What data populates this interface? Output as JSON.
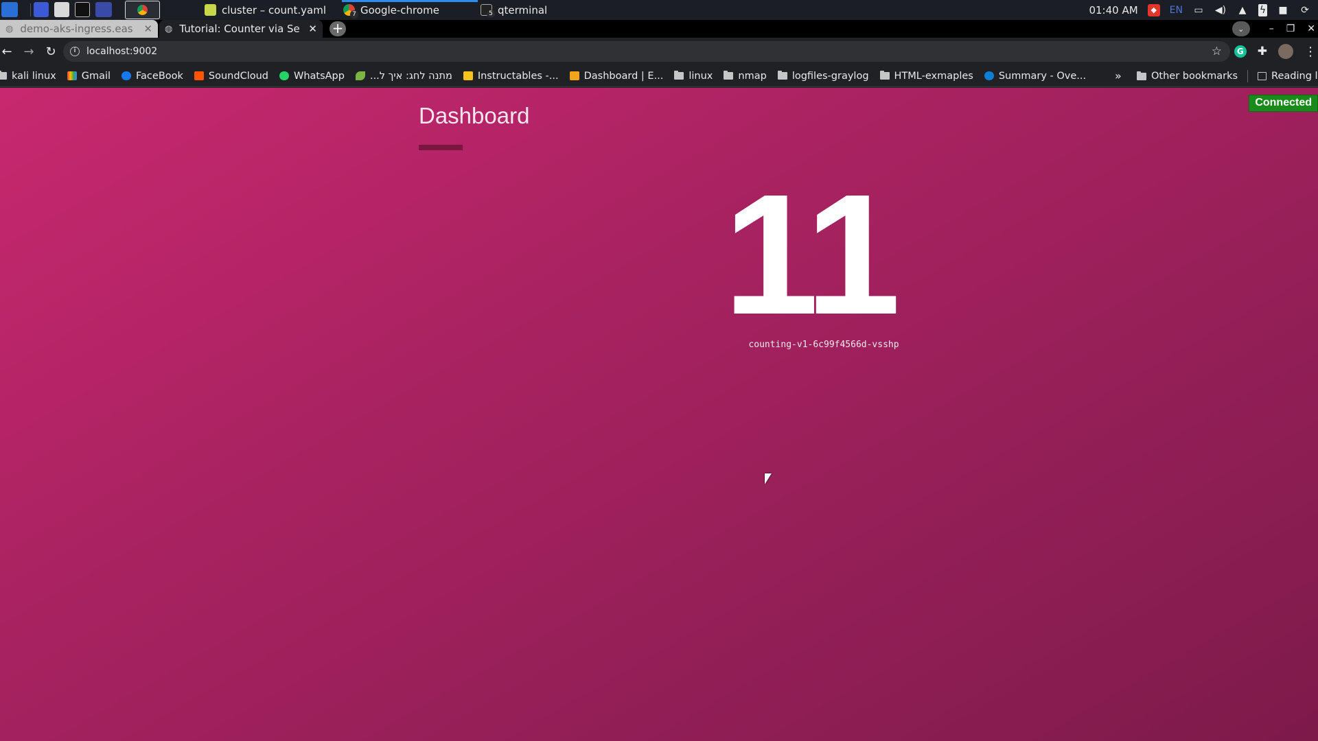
{
  "taskbar": {
    "windows": [
      {
        "label": "cluster – count.yaml",
        "icon": "text-editor-icon"
      },
      {
        "label": "Google-chrome",
        "icon": "chrome-icon",
        "badge": "7"
      },
      {
        "label": "qterminal",
        "icon": "terminal-icon",
        "badge": "5"
      }
    ],
    "clock": "01:40 AM",
    "language": "EN"
  },
  "browser": {
    "tabs": [
      {
        "title": "demo-aks-ingress.eastus",
        "active": false
      },
      {
        "title": "Tutorial: Counter via Servi",
        "active": true
      }
    ],
    "url": "localhost:9002",
    "bookmarks": [
      {
        "label": "kali linux",
        "icon": "kali-icon"
      },
      {
        "label": "Gmail",
        "icon": "gmail-icon"
      },
      {
        "label": "FaceBook",
        "icon": "facebook-icon"
      },
      {
        "label": "SoundCloud",
        "icon": "soundcloud-icon"
      },
      {
        "label": "WhatsApp",
        "icon": "whatsapp-icon"
      },
      {
        "label": "מתנה לחג: איך ל...",
        "icon": "leaf-icon"
      },
      {
        "label": "Instructables -...",
        "icon": "instructables-icon"
      },
      {
        "label": "Dashboard | E...",
        "icon": "box-icon"
      },
      {
        "label": "linux",
        "icon": "folder-icon"
      },
      {
        "label": "nmap",
        "icon": "folder-icon"
      },
      {
        "label": "logfiles-graylog",
        "icon": "folder-icon"
      },
      {
        "label": "HTML-exmaples",
        "icon": "folder-icon"
      },
      {
        "label": "Summary - Ove...",
        "icon": "azure-icon"
      }
    ],
    "bookmarks_more": "»",
    "other_bookmarks": "Other bookmarks",
    "reading_list": "Reading list"
  },
  "page": {
    "title": "Dashboard",
    "counter": "11",
    "pod_name": "counting-v1-6c99f4566d-vsshp",
    "status": "Connected",
    "colors": {
      "background_start": "#c8286f",
      "background_end": "#7d1a4a",
      "status_green": "#1a8a1a"
    }
  }
}
